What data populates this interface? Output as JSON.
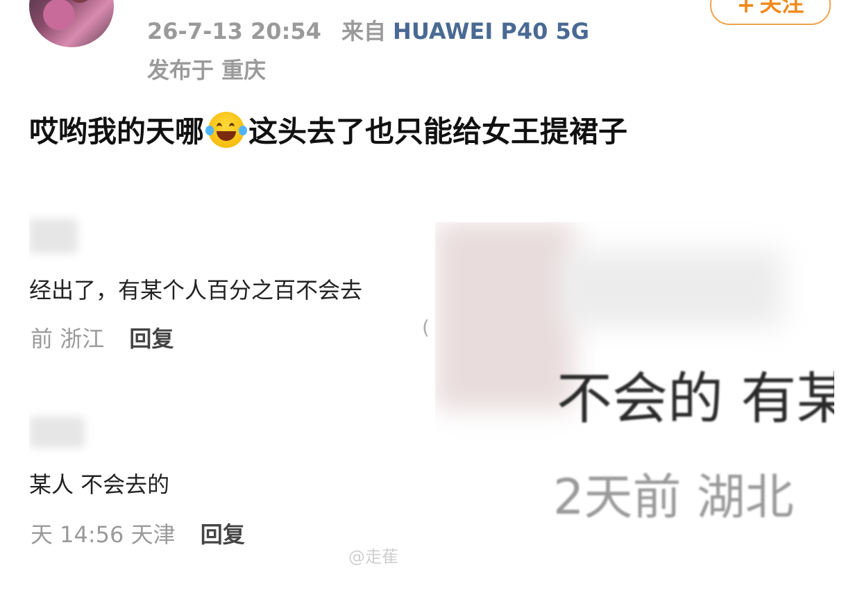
{
  "header": {
    "follow_label": "关注",
    "timestamp": "26-7-13 20:54",
    "from_label": "来自",
    "device": "HUAWEI P40 5G",
    "location_label": "发布于 重庆"
  },
  "post": {
    "text_before": "哎哟我的天哪",
    "emoji": "laughing-tears-icon",
    "text_after": "这头去了也只能给女王提裙子"
  },
  "left_screenshot": {
    "comment1": {
      "text": "经出了，有某个人百分之百不会去",
      "meta_time": "前",
      "meta_region": "浙江",
      "reply_label": "回复"
    },
    "comment2": {
      "text": "某人 不会去的",
      "meta_time": "天 14:56",
      "meta_region": "天津",
      "reply_label": "回复"
    },
    "watermark": "@走萑"
  },
  "right_screenshot": {
    "text": "不会的 有某",
    "meta": "2天前 湖北"
  },
  "colors": {
    "follow_orange": "#f08a1c",
    "device_blue": "#4a6a94",
    "meta_gray": "#9a9a9a"
  }
}
